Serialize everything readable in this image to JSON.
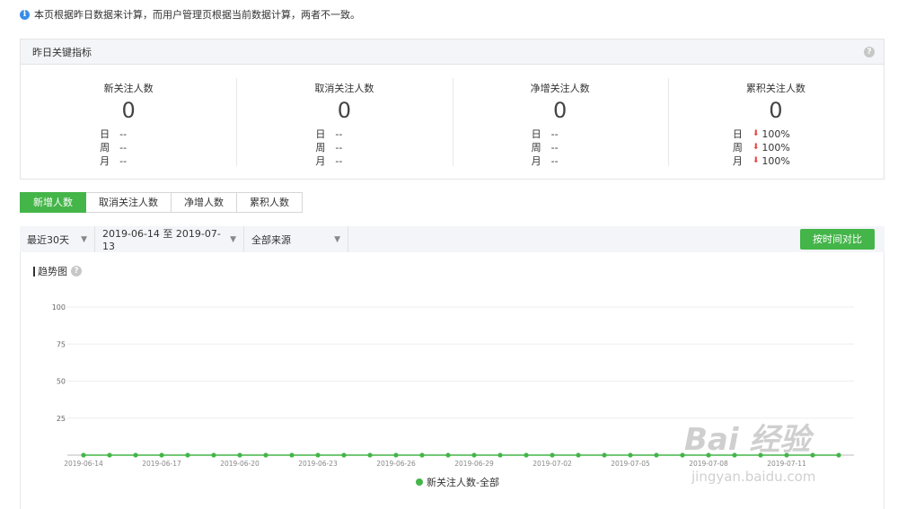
{
  "notice": {
    "text": "本页根据昨日数据来计算，而用户管理页根据当前数据计算，两者不一致。"
  },
  "panel": {
    "title": "昨日关键指标",
    "metrics": [
      {
        "title": "新关注人数",
        "value": "0",
        "rows": [
          {
            "label": "日",
            "value": "--"
          },
          {
            "label": "周",
            "value": "--"
          },
          {
            "label": "月",
            "value": "--"
          }
        ]
      },
      {
        "title": "取消关注人数",
        "value": "0",
        "rows": [
          {
            "label": "日",
            "value": "--"
          },
          {
            "label": "周",
            "value": "--"
          },
          {
            "label": "月",
            "value": "--"
          }
        ]
      },
      {
        "title": "净增关注人数",
        "value": "0",
        "rows": [
          {
            "label": "日",
            "value": "--"
          },
          {
            "label": "周",
            "value": "--"
          },
          {
            "label": "月",
            "value": "--"
          }
        ]
      },
      {
        "title": "累积关注人数",
        "value": "0",
        "rows": [
          {
            "label": "日",
            "value": "100%"
          },
          {
            "label": "周",
            "value": "100%"
          },
          {
            "label": "月",
            "value": "100%"
          }
        ]
      }
    ]
  },
  "tabs": [
    "新增人数",
    "取消关注人数",
    "净增人数",
    "累积人数"
  ],
  "filters": {
    "period": "最近30天",
    "range": "2019-06-14 至 2019-07-13",
    "source": "全部来源",
    "compare": "按时间对比"
  },
  "chart_title": "趋势图",
  "colors": {
    "accent": "#44b549",
    "down": "#e54545"
  },
  "chart_data": {
    "type": "line",
    "ylim": [
      0,
      100
    ],
    "yticks": [
      25,
      50,
      75,
      100
    ],
    "xticks": [
      "2019-06-14",
      "2019-06-17",
      "2019-06-20",
      "2019-06-23",
      "2019-06-26",
      "2019-06-29",
      "2019-07-02",
      "2019-07-05",
      "2019-07-08",
      "2019-07-11"
    ],
    "x": [
      "2019-06-14",
      "2019-06-15",
      "2019-06-16",
      "2019-06-17",
      "2019-06-18",
      "2019-06-19",
      "2019-06-20",
      "2019-06-21",
      "2019-06-22",
      "2019-06-23",
      "2019-06-24",
      "2019-06-25",
      "2019-06-26",
      "2019-06-27",
      "2019-06-28",
      "2019-06-29",
      "2019-06-30",
      "2019-07-01",
      "2019-07-02",
      "2019-07-03",
      "2019-07-04",
      "2019-07-05",
      "2019-07-06",
      "2019-07-07",
      "2019-07-08",
      "2019-07-09",
      "2019-07-10",
      "2019-07-11",
      "2019-07-12",
      "2019-07-13"
    ],
    "series": [
      {
        "name": "新关注人数-全部",
        "values": [
          0,
          0,
          0,
          0,
          0,
          0,
          0,
          0,
          0,
          0,
          0,
          0,
          0,
          0,
          0,
          0,
          0,
          0,
          0,
          0,
          0,
          0,
          0,
          0,
          0,
          0,
          0,
          0,
          0,
          0
        ]
      }
    ]
  },
  "watermark": {
    "brand": "Bai 经验",
    "url": "jingyan.baidu.com"
  }
}
